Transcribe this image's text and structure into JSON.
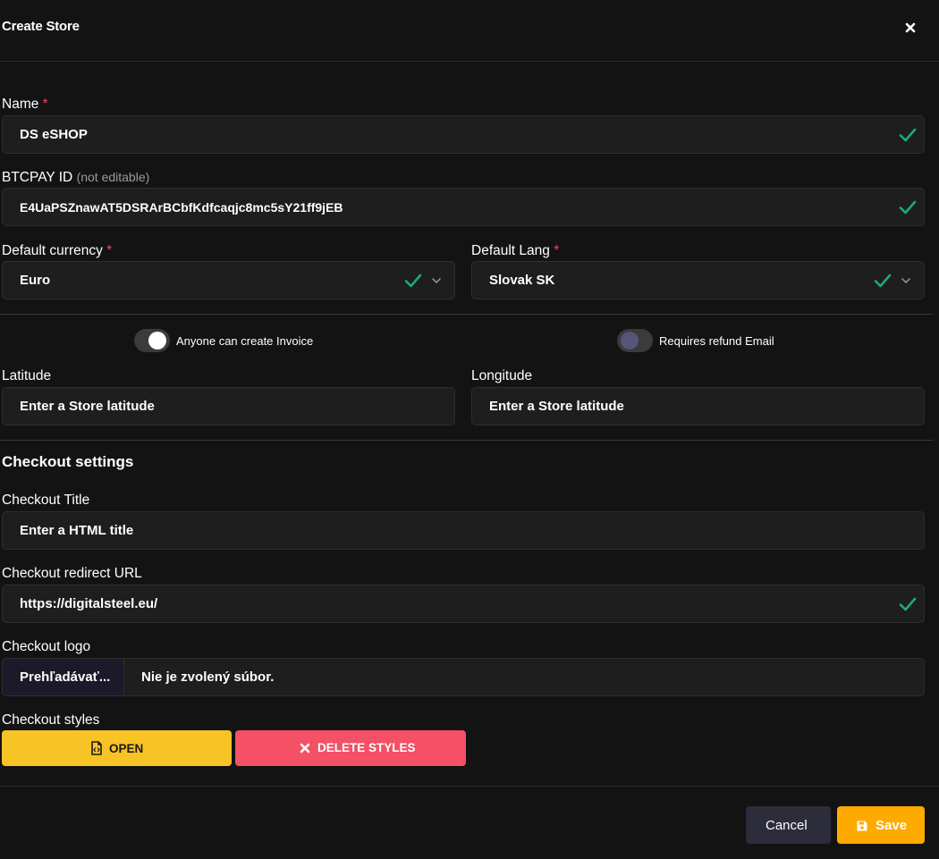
{
  "dialog": {
    "title": "Create Store",
    "close_icon": "close-icon"
  },
  "colors": {
    "background": "#131313",
    "field_bg": "#1e1e1e",
    "valid_green": "#1ea97c",
    "required_red": "#f3425c",
    "open_yellow": "#f8c324",
    "delete_red": "#f45066",
    "save_orange": "#ffaa00",
    "cancel_bg": "#2c2c3b"
  },
  "form": {
    "name": {
      "label": "Name",
      "required_mark": "*",
      "value": "DS eSHOP",
      "valid": true
    },
    "btcpay_id": {
      "label": "BTCPAY ID",
      "hint": "(not editable)",
      "value": "E4UaPSZnawAT5DSRArBCbfKdfcaqjc8mc5sY21ff9jEB",
      "valid": true
    },
    "default_currency": {
      "label": "Default currency",
      "required_mark": "*",
      "value": "Euro",
      "valid": true
    },
    "default_lang": {
      "label": "Default Lang",
      "required_mark": "*",
      "value": "Slovak SK",
      "valid": true
    },
    "toggles": [
      {
        "label": "Anyone can create Invoice",
        "on": true
      },
      {
        "label": "Requires refund Email",
        "on": false
      }
    ],
    "latitude": {
      "label": "Latitude",
      "placeholder": "Enter a Store latitude"
    },
    "longitude": {
      "label": "Longitude",
      "placeholder": "Enter a Store latitude"
    }
  },
  "checkout": {
    "section_title": "Checkout settings",
    "title": {
      "label": "Checkout Title",
      "placeholder": "Enter a HTML title"
    },
    "redirect_url": {
      "label": "Checkout redirect URL",
      "value": "https://digitalsteel.eu/",
      "valid": true
    },
    "logo": {
      "label": "Checkout logo",
      "browse_label": "Prehľadávať...",
      "status": "Nie je zvolený súbor."
    },
    "styles": {
      "label": "Checkout styles",
      "open_label": "OPEN",
      "open_icon": "file-code-icon",
      "delete_label": "DELETE STYLES",
      "delete_icon": "close-icon"
    }
  },
  "footer": {
    "cancel_label": "Cancel",
    "save_label": "Save",
    "save_icon": "floppy-disk-icon"
  }
}
